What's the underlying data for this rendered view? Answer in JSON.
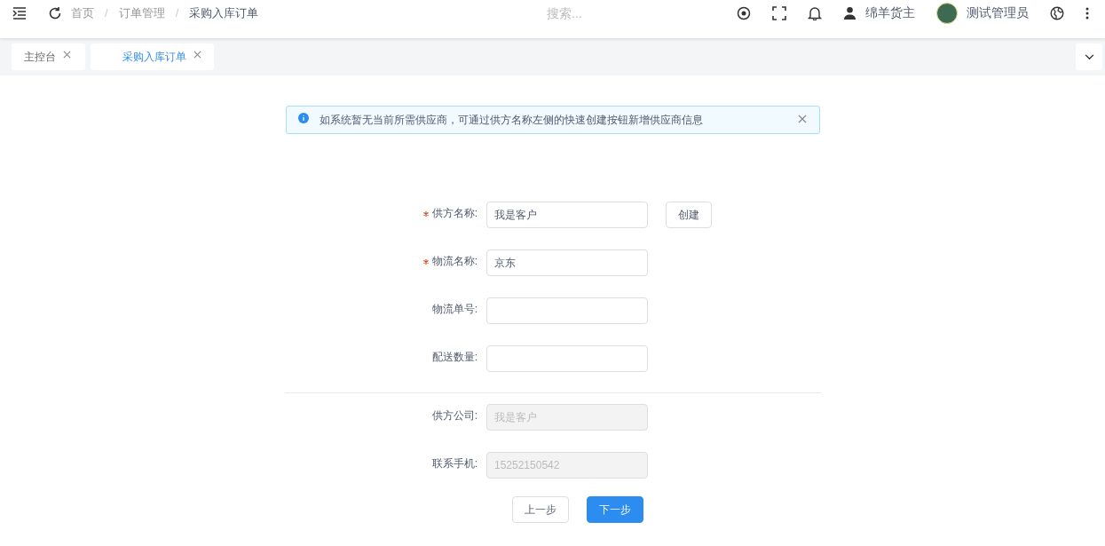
{
  "breadcrumb": {
    "separator": "/",
    "items": [
      "首页",
      "订单管理",
      "采购入库订单"
    ]
  },
  "search": {
    "placeholder": "搜索..."
  },
  "user": {
    "role": "绵羊货主",
    "name": "测试管理员"
  },
  "tabs": [
    {
      "label": "主控台",
      "selected": false
    },
    {
      "label": "采购入库订单",
      "selected": true
    }
  ],
  "alert": {
    "text": "如系统暂无当前所需供应商，可通过供方名称左侧的快速创建按钮新增供应商信息"
  },
  "form": {
    "fields": [
      {
        "label": "供方名称:",
        "value": "我是客户",
        "required": true,
        "action": "创建"
      },
      {
        "label": "物流名称:",
        "value": "京东",
        "required": true
      },
      {
        "label": "物流单号:",
        "required": false
      },
      {
        "label": "配送数量:",
        "required": false
      }
    ],
    "supplier_info": [
      {
        "label": "供方公司:",
        "value": "我是客户",
        "disabled": true
      },
      {
        "label": "联系手机:",
        "value": "15252150542",
        "disabled": true
      }
    ],
    "buttons": [
      {
        "label": "上一步",
        "primary": false
      },
      {
        "label": "下一步",
        "primary": true
      }
    ]
  }
}
